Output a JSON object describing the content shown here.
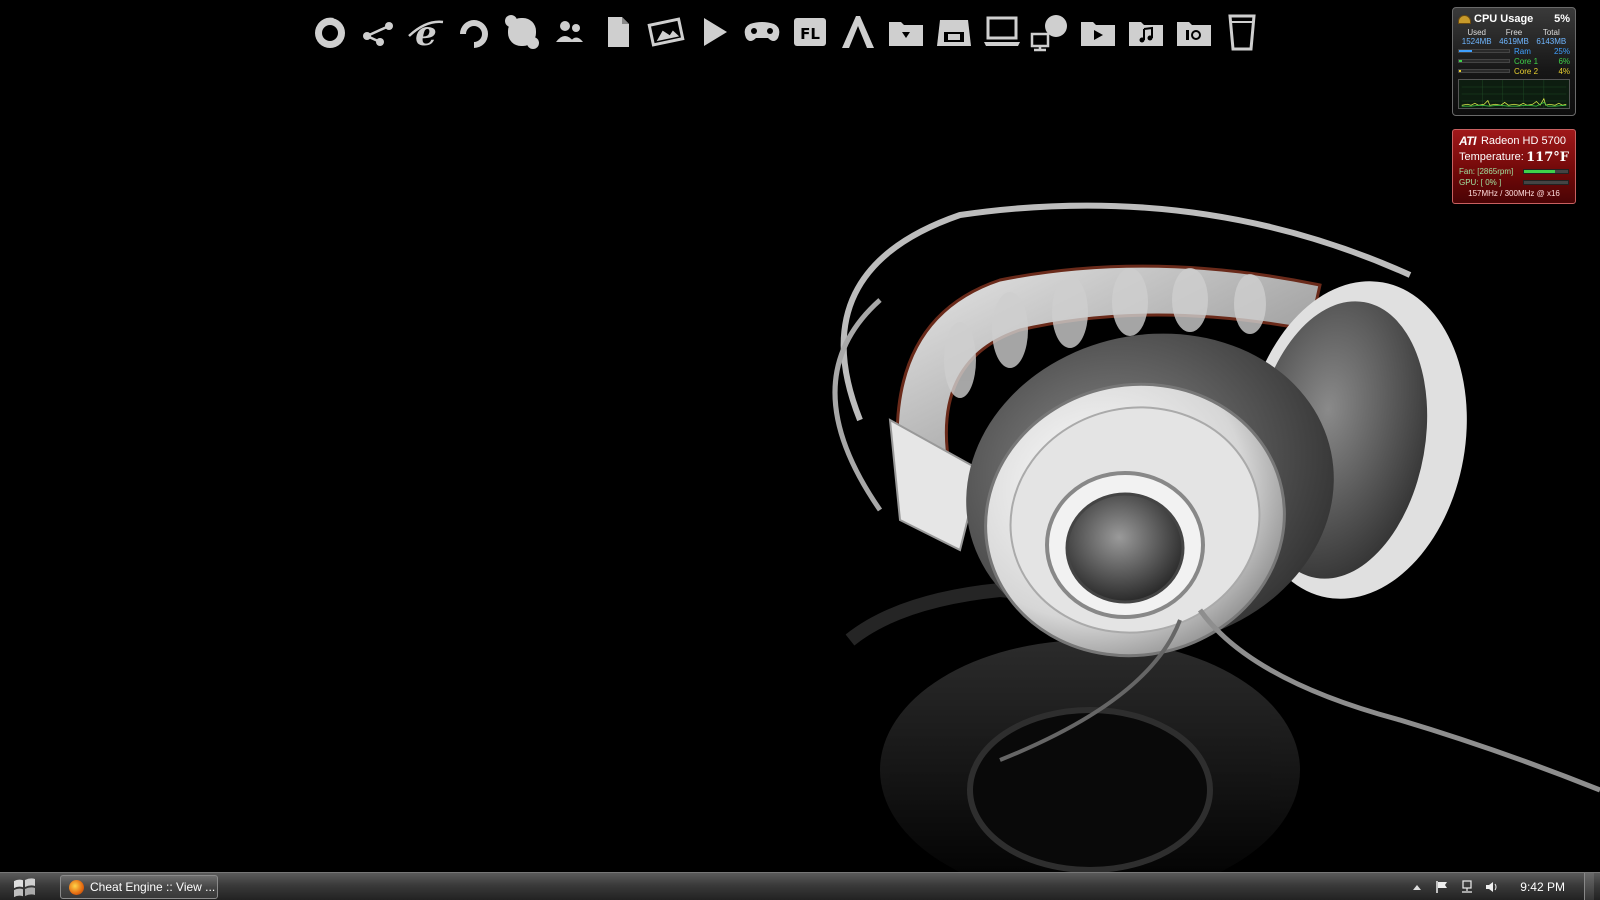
{
  "dock": {
    "icons": [
      {
        "name": "firefox-icon"
      },
      {
        "name": "network-share-icon"
      },
      {
        "name": "internet-explorer-icon"
      },
      {
        "name": "opera-icon"
      },
      {
        "name": "skype-icon"
      },
      {
        "name": "users-icon"
      },
      {
        "name": "document-icon"
      },
      {
        "name": "photo-icon"
      },
      {
        "name": "play-icon"
      },
      {
        "name": "game-controller-icon"
      },
      {
        "name": "fl-studio-icon",
        "text": "FL"
      },
      {
        "name": "text-editor-icon"
      },
      {
        "name": "downloads-folder-icon"
      },
      {
        "name": "drive-icon"
      },
      {
        "name": "computer-icon"
      },
      {
        "name": "network-icon"
      },
      {
        "name": "videos-folder-icon"
      },
      {
        "name": "music-folder-icon"
      },
      {
        "name": "pictures-folder-icon"
      },
      {
        "name": "recycle-bin-icon"
      }
    ]
  },
  "cpu_gadget": {
    "title": "CPU Usage",
    "total_percent": "5%",
    "headers": [
      "Used",
      "Free",
      "Total"
    ],
    "values": [
      "1524MB",
      "4619MB",
      "6143MB"
    ],
    "meters": [
      {
        "label": "Ram",
        "percent_text": "25%",
        "fraction": 0.25,
        "color": "#3fa0ff"
      },
      {
        "label": "Core 1",
        "percent_text": "6%",
        "fraction": 0.06,
        "color": "#3fd24a"
      },
      {
        "label": "Core 2",
        "percent_text": "4%",
        "fraction": 0.04,
        "color": "#e8d030"
      }
    ]
  },
  "gpu_gadget": {
    "brand": "ATI",
    "model": "Radeon HD 5700",
    "temp_label": "Temperature:",
    "temp_value": "117°F",
    "fan_label": "Fan: [2865rpm]",
    "fan_fraction": 0.7,
    "gpu_label": "GPU: [ 0% ]",
    "gpu_fraction": 0.0,
    "clock": "157MHz / 300MHz @ x16"
  },
  "taskbar": {
    "task_label": "Cheat Engine :: View ...",
    "clock": "9:42 PM"
  },
  "colors": {
    "taskbar": "#3a3a3a",
    "gpu_gadget": "#8a0e10",
    "accent_green": "#3fd24a"
  }
}
